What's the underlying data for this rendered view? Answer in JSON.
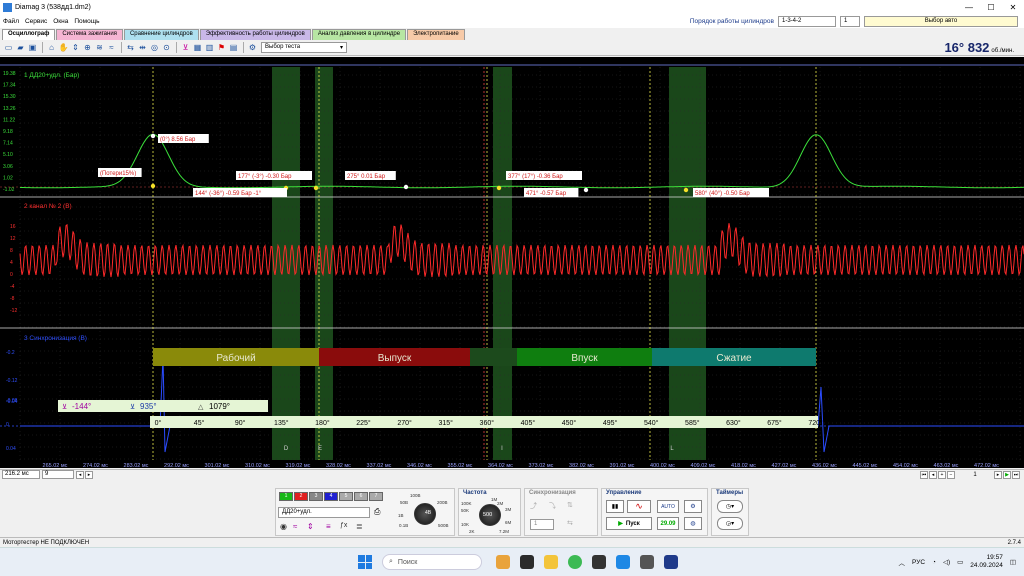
{
  "window": {
    "title": "Diamag 3 (538дд1.dm2)",
    "minimize": "—",
    "maximize": "☐",
    "close": "✕"
  },
  "menu": {
    "items": [
      "Файл",
      "Сервис",
      "Окна",
      "Помощь"
    ],
    "firing_order_label": "Порядок работы цилиндров",
    "firing_order_value": "1-3-4-2",
    "cylinder_value": "1",
    "auto_select_label": "Выбор авто"
  },
  "tabs": [
    {
      "label": "Осциллограф",
      "color": "#ffffff"
    },
    {
      "label": "Система зажигания",
      "color": "#f5b5d3"
    },
    {
      "label": "Сравнение цилиндров",
      "color": "#aee0ef"
    },
    {
      "label": "Эффективность работы цилиндров",
      "color": "#c9b8e8"
    },
    {
      "label": "Анализ давления в цилиндре",
      "color": "#b7e6a3"
    },
    {
      "label": "Электропитание",
      "color": "#f7caa8"
    }
  ],
  "toolbar": {
    "test_select_label": "Выбор теста",
    "rpm_value": "16° 832",
    "rpm_unit": "об./мин."
  },
  "channel1": {
    "label": "1 ДД20+удл. (Бар)",
    "yticks": [
      "19.38",
      "17.34",
      "15.30",
      "13.26",
      "11.22",
      "9.18",
      "7.14",
      "5.10",
      "3.06",
      "1.02",
      "-1.02"
    ],
    "annotations": [
      "(0°) 8.56 Бар",
      "(Потери15%)",
      "177° (-3°) -0.30 Бар",
      "144° (-36°) -0.59 Бар -1°",
      "275° 0.01 Бар",
      "377° (17°) -0.36 Бар",
      "471° -0.57 Бар",
      "580° (40°) -0.50 Бар"
    ]
  },
  "channel2": {
    "label": "2 канал № 2 (В)",
    "yticks": [
      "16",
      "12",
      "8",
      "4",
      "0",
      "-4",
      "-8",
      "-12"
    ]
  },
  "channel3": {
    "label": "3 Синхронизация (В)",
    "yticks": [
      "-0.2",
      "-0.12",
      "-0.08",
      "-0.04",
      "0",
      "0.04"
    ]
  },
  "phases": [
    {
      "label": "Рабочий",
      "color": "#8a8a0a"
    },
    {
      "label": "Выпуск",
      "color": "#8a0c0c"
    },
    {
      "label": "",
      "color": "#1c4a1c"
    },
    {
      "label": "Впуск",
      "color": "#0f7e0f"
    },
    {
      "label": "Сжатие",
      "color": "#0e7a6e"
    }
  ],
  "markers": {
    "m1": "-144°",
    "m2": "935°",
    "m3": "1079°"
  },
  "degree_ticks": [
    "0°",
    "45°",
    "90°",
    "135°",
    "180°",
    "225°",
    "270°",
    "315°",
    "360°",
    "405°",
    "450°",
    "495°",
    "540°",
    "585°",
    "630°",
    "675°",
    "720°"
  ],
  "valve_letters": [
    "D",
    "E",
    "I",
    "L"
  ],
  "time_ticks": [
    "265.02 мс",
    "274.02 мс",
    "283.02 мс",
    "292.02 мс",
    "301.02 мс",
    "310.02 мс",
    "319.02 мс",
    "328.02 мс",
    "337.02 мс",
    "346.02 мс",
    "355.02 мс",
    "364.02 мс",
    "373.02 мс",
    "382.02 мс",
    "391.02 мс",
    "400.02 мс",
    "409.02 мс",
    "418.02 мс",
    "427.02 мс",
    "436.02 мс",
    "445.02 мс",
    "454.02 мс",
    "463.02 мс",
    "472.02 мс"
  ],
  "nav": {
    "timebase": "216.2 мс",
    "count": "9",
    "page": "1"
  },
  "control": {
    "channels": [
      "1",
      "2",
      "3",
      "4",
      "5",
      "6",
      "7"
    ],
    "channel_colors": [
      "#18b818",
      "#e02020",
      "#888888",
      "#2020d0",
      "#aaaaaa",
      "#aaaaaa",
      "#aaaaaa"
    ],
    "sensor_value": "ДД20+удл.",
    "range_labels": [
      "100B",
      "50B",
      "200B",
      "1B",
      "500B",
      "0.1B"
    ],
    "range_value": "4B",
    "freq_title": "Частота",
    "freq_labels": [
      "100K",
      "50K",
      "2M",
      "1M",
      "3M",
      "10K",
      "6M",
      "2K",
      "7.2M"
    ],
    "freq_value": "500",
    "sync_title": "Синхронизация",
    "sync_value": "1",
    "mgmt_title": "Управление",
    "start_label": "Пуск",
    "freq_readout": "29.09",
    "timers_title": "Таймеры"
  },
  "status": {
    "text": "Мотортестер НЕ ПОДКЛЮЧЕН",
    "version": "2.7.4"
  },
  "taskbar": {
    "search": "Поиск",
    "lang": "РУС",
    "time": "19:57",
    "date": "24.09.2024"
  }
}
